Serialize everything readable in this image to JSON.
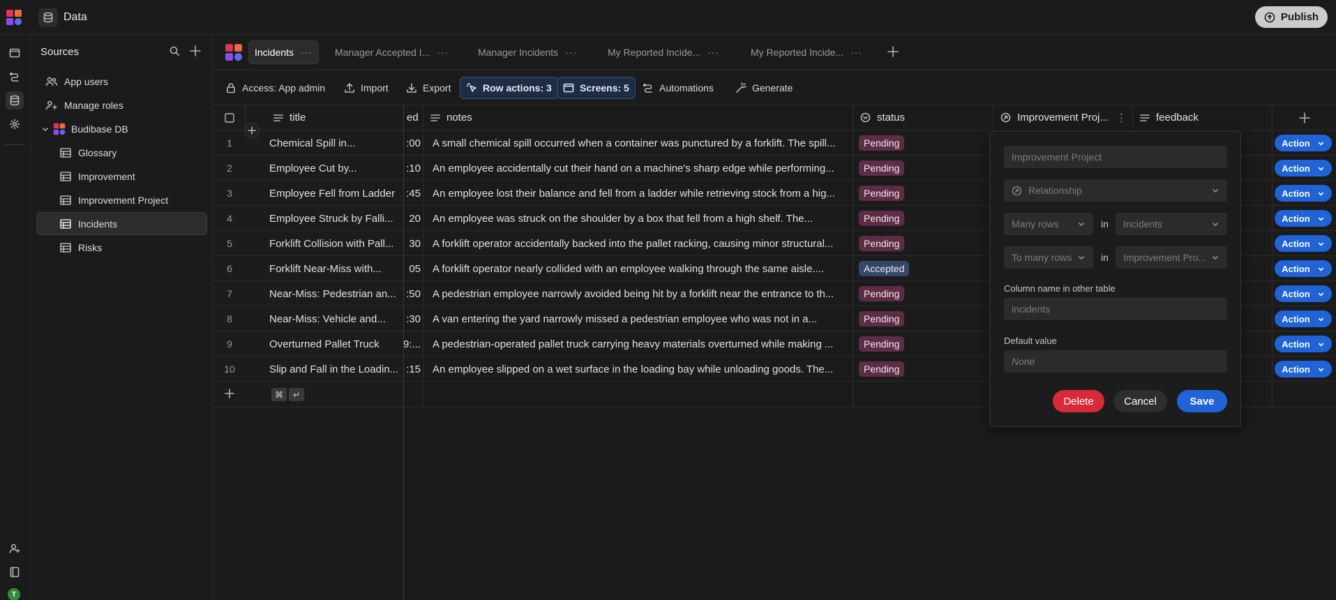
{
  "topbar": {
    "title": "Data",
    "publish_label": "Publish"
  },
  "sidebar": {
    "heading": "Sources",
    "items": [
      {
        "label": "App users",
        "icon": "users-icon"
      },
      {
        "label": "Manage roles",
        "icon": "user-roles-icon"
      },
      {
        "label": "Budibase DB",
        "icon": "budibase-db-icon"
      },
      {
        "label": "Glossary",
        "icon": "table-icon"
      },
      {
        "label": "Improvement",
        "icon": "table-icon"
      },
      {
        "label": "Improvement Project",
        "icon": "table-icon"
      },
      {
        "label": "Incidents",
        "icon": "table-icon"
      },
      {
        "label": "Risks",
        "icon": "table-icon"
      }
    ]
  },
  "tabs": [
    {
      "label": "Incidents"
    },
    {
      "label": "Manager Accepted I..."
    },
    {
      "label": "Manager Incidents"
    },
    {
      "label": "My Reported Incide..."
    },
    {
      "label": "My Reported Incide..."
    }
  ],
  "toolbar": {
    "access": "Access: App admin",
    "import": "Import",
    "export": "Export",
    "row_actions": "Row actions: 3",
    "screens": "Screens: 5",
    "automations": "Automations",
    "generate": "Generate"
  },
  "columns": {
    "title": "title",
    "date_partial": "ed",
    "notes": "notes",
    "status": "status",
    "improvement": "Improvement Proj...",
    "feedback": "feedback"
  },
  "rows": [
    {
      "n": "1",
      "title": "Chemical Spill in...",
      "time": ":00",
      "notes": "A small chemical spill occurred when a container was punctured by a forklift. The spill...",
      "status": "Pending"
    },
    {
      "n": "2",
      "title": "Employee Cut by...",
      "time": ":10",
      "notes": "An employee accidentally cut their hand on a machine's sharp edge while performing...",
      "status": "Pending"
    },
    {
      "n": "3",
      "title": "Employee Fell from Ladder",
      "time": ":45",
      "notes": "An employee lost their balance and fell from a ladder while retrieving stock from a hig...",
      "status": "Pending"
    },
    {
      "n": "4",
      "title": "Employee Struck by Falli...",
      "time": "20",
      "notes": "An employee was struck on the shoulder by a box that fell from a high shelf. The...",
      "status": "Pending"
    },
    {
      "n": "5",
      "title": "Forklift Collision with Pall...",
      "time": "30",
      "notes": "A forklift operator accidentally backed into the pallet racking, causing minor structural...",
      "status": "Pending"
    },
    {
      "n": "6",
      "title": "Forklift Near-Miss with...",
      "time": "05",
      "notes": "A forklift operator nearly collided with an employee walking through the same aisle....",
      "status": "Accepted"
    },
    {
      "n": "7",
      "title": "Near-Miss: Pedestrian an...",
      "time": ":50",
      "notes": "A pedestrian employee narrowly avoided being hit by a forklift near the entrance to th...",
      "status": "Pending"
    },
    {
      "n": "8",
      "title": "Near-Miss: Vehicle and...",
      "time": ":30",
      "notes": "A van entering the yard narrowly missed a pedestrian employee who was not in a...",
      "status": "Pending"
    },
    {
      "n": "9",
      "title": "Overturned Pallet Truck",
      "time": "9:...",
      "notes": "A pedestrian-operated pallet truck carrying heavy materials overturned while making ...",
      "status": "Pending"
    },
    {
      "n": "10",
      "title": "Slip and Fall in the Loadin...",
      "time": ":15",
      "notes": "An employee slipped on a wet surface in the loading bay while unloading goods. The...",
      "status": "Pending"
    }
  ],
  "row_action_label": "Action",
  "new_row_keys": {
    "cmd": "⌘",
    "enter": "↵"
  },
  "popover": {
    "name_placeholder": "Improvement Project",
    "type_value": "Relationship",
    "rel_left": "Many rows",
    "in1": "in",
    "table_left": "Incidents",
    "rel_right": "To many rows",
    "in2": "in",
    "table_right": "Improvement Pro...",
    "column_label": "Column name in other table",
    "column_value": "incidents",
    "default_label": "Default value",
    "default_value": "None",
    "delete_label": "Delete",
    "cancel_label": "Cancel",
    "save_label": "Save"
  },
  "colors": {
    "pending_bg": "#5d2c46",
    "accepted_bg": "#344768",
    "primary": "#1f63d6",
    "danger": "#d92a3a"
  }
}
